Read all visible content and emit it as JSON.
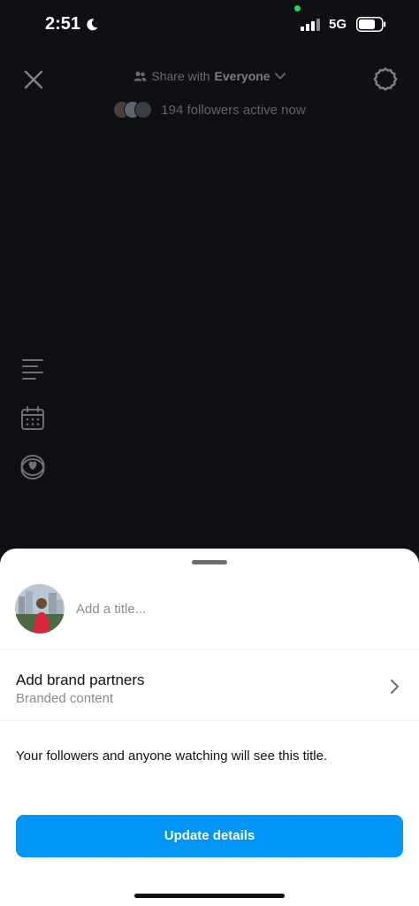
{
  "status_bar": {
    "time": "2:51",
    "network": "5G",
    "icons": [
      "moon-icon",
      "signal-icon",
      "battery-icon"
    ]
  },
  "header": {
    "share_prefix": "Share with",
    "audience": "Everyone",
    "active_text": "194 followers active now",
    "icons": [
      "close-icon",
      "people-icon",
      "chevron-down-icon",
      "settings-icon"
    ]
  },
  "side_tools": [
    "text-lines-icon",
    "calendar-icon",
    "heart-badge-icon"
  ],
  "sheet": {
    "title_placeholder": "Add a title...",
    "title_value": "",
    "brand_label": "Add brand partners",
    "brand_sub": "Branded content",
    "info": "Your followers and anyone watching will see this title.",
    "button_label": "Update details"
  },
  "colors": {
    "background": "#0f1014",
    "sheet": "#ffffff",
    "accent": "#0095f6",
    "status_dot": "#30d158"
  }
}
